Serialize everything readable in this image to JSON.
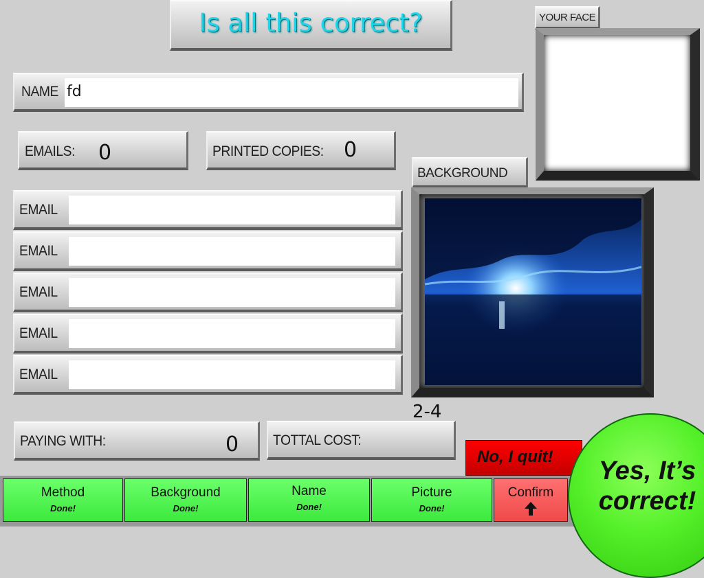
{
  "header": {
    "title": "Is all this correct?"
  },
  "face": {
    "label": "YOUR FACE"
  },
  "name": {
    "label": "NAME",
    "value": "fd"
  },
  "emails_count": {
    "label": "EMAILS:",
    "value": "0"
  },
  "printed_copies": {
    "label": "PRINTED COPIES:",
    "value": "0"
  },
  "emails": [
    {
      "label": "EMAIL",
      "value": ""
    },
    {
      "label": "EMAIL",
      "value": ""
    },
    {
      "label": "EMAIL",
      "value": ""
    },
    {
      "label": "EMAIL",
      "value": ""
    },
    {
      "label": "EMAIL",
      "value": ""
    }
  ],
  "background": {
    "label": "BACKGROUND",
    "code": "2-4"
  },
  "paying_with": {
    "label": "PAYING WITH:",
    "value": "0"
  },
  "total_cost": {
    "label": "TOTTAL COST:",
    "value": ""
  },
  "actions": {
    "quit_label": "No, I quit!",
    "confirm_label": "Yes, It’s correct!"
  },
  "nav": [
    {
      "title": "Method",
      "status": "Done!"
    },
    {
      "title": "Background",
      "status": "Done!"
    },
    {
      "title": "Name",
      "status": "Done!"
    },
    {
      "title": "Picture",
      "status": "Done!"
    },
    {
      "title": "Confirm",
      "icon": "up-arrow-icon"
    }
  ],
  "colors": {
    "title_cyan": "#20d4e8",
    "nav_green": "#4cf04c",
    "confirm_red": "#ff5a5a",
    "quit_red": "#e00000"
  }
}
